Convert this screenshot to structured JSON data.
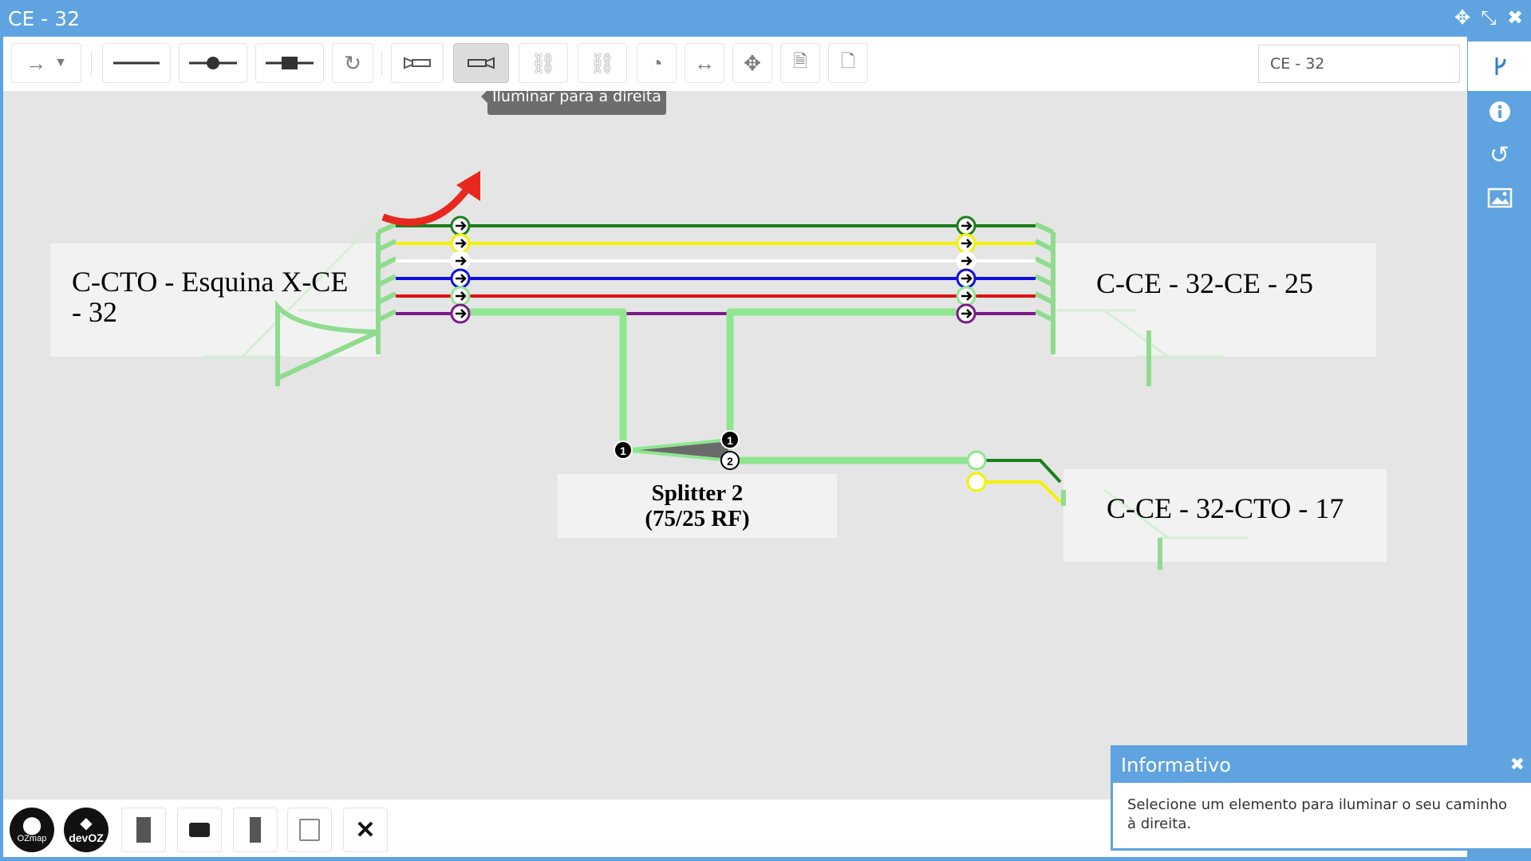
{
  "window": {
    "title": "CE - 32"
  },
  "toolbar": {
    "search_value": "CE - 32",
    "tooltip": "Iluminar para a direita"
  },
  "canvas": {
    "left_box_label_line1": "C-CTO - Esquina X-CE",
    "left_box_label_line2": "- 32",
    "right_top_box_label": "C-CE - 32-CE - 25",
    "right_bottom_box_label": "C-CE - 32-CTO - 17",
    "splitter_label_line1": "Splitter 2",
    "splitter_label_line2": "(75/25 RF)",
    "port_in": "1",
    "port_out1": "1",
    "port_out2": "2",
    "fiber_colors": [
      "#1b7f1b",
      "#f2f200",
      "#ffffff",
      "#1010e0",
      "#e01010",
      "#7a1a8a"
    ]
  },
  "bottombar": {
    "logo_ozmap": "OZmap",
    "logo_devoz": "devOZ"
  },
  "info_panel": {
    "title": "Informativo",
    "message": "Selecione um elemento para iluminar o seu caminho à direita."
  }
}
